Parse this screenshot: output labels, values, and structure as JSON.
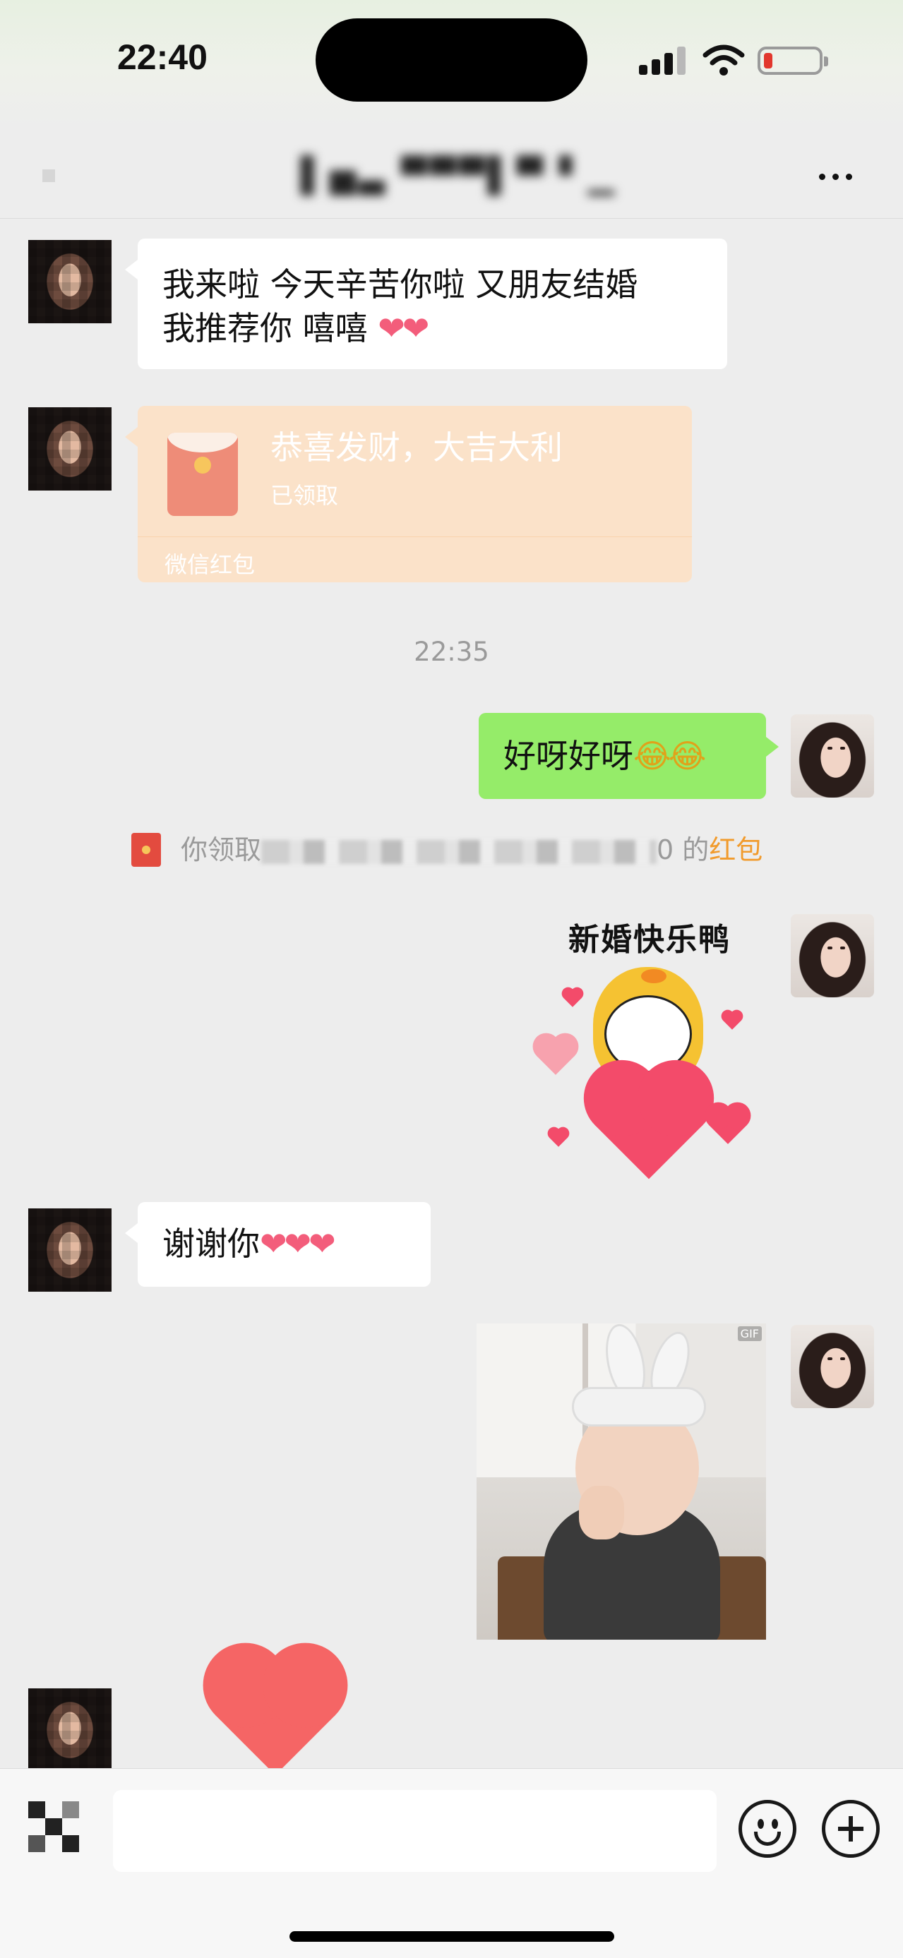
{
  "status_bar": {
    "time": "22:40",
    "signal_icon": "cellular-signal-icon",
    "wifi_icon": "wifi-icon",
    "battery_icon": "battery-low-icon",
    "battery_color": "#e2372d"
  },
  "nav": {
    "title": "▌▅▃ ▀▀▀▌▀ ▘▁",
    "more_icon": "more-dots-icon"
  },
  "messages": [
    {
      "sender": "other",
      "type": "text",
      "text": "我来啦 今天辛苦你啦  又朋友结婚",
      "text_line2": "我推荐你 嘻嘻 ",
      "emoji": "❤❤"
    },
    {
      "sender": "other",
      "type": "red_packet",
      "greeting": "恭喜发财，大吉大利",
      "status": "已领取",
      "brand": "微信红包"
    },
    {
      "type": "timestamp",
      "text": "22:35"
    },
    {
      "sender": "self",
      "type": "text",
      "text": "好呀好呀",
      "emoji": "😂😂"
    },
    {
      "type": "system",
      "prefix": "你领取",
      "suffix": "0 的",
      "link": "红包"
    },
    {
      "sender": "self",
      "type": "sticker",
      "caption": "新婚快乐鸭"
    },
    {
      "sender": "other",
      "type": "text",
      "text": "谢谢你",
      "emoji": "❤❤❤"
    },
    {
      "sender": "self",
      "type": "image",
      "badge": "GIF"
    },
    {
      "sender": "other",
      "type": "sticker",
      "description": "heart-sticker"
    }
  ],
  "input_bar": {
    "voice_icon": "voice-input-icon",
    "input_value": "",
    "emoji_icon": "emoji-icon",
    "plus_icon": "plus-icon"
  },
  "colors": {
    "background": "#ededed",
    "self_bubble": "#95ec69",
    "other_bubble": "#ffffff",
    "red_packet": "#fbe2c9",
    "link": "#f19b2d"
  }
}
